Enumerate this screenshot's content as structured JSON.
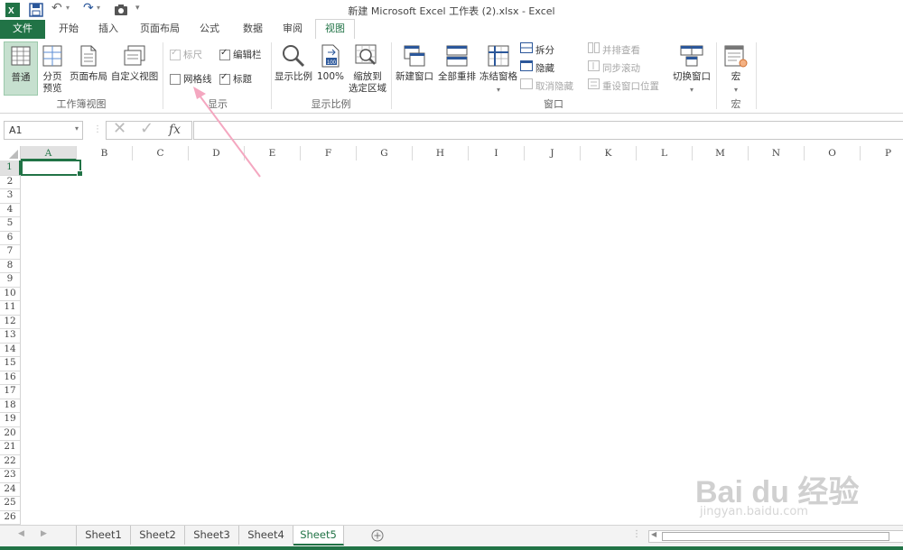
{
  "window": {
    "title": "新建 Microsoft Excel 工作表 (2).xlsx - Excel"
  },
  "tabs": [
    {
      "label": "文件"
    },
    {
      "label": "开始"
    },
    {
      "label": "插入"
    },
    {
      "label": "页面布局"
    },
    {
      "label": "公式"
    },
    {
      "label": "数据"
    },
    {
      "label": "审阅"
    },
    {
      "label": "视图"
    }
  ],
  "ribbon": {
    "workbook_views": {
      "label": "工作簿视图",
      "normal": "普通",
      "page_break_line1": "分页",
      "page_break_line2": "预览",
      "page_layout": "页面布局",
      "custom_views": "自定义视图"
    },
    "show": {
      "label": "显示",
      "ruler": "标尺",
      "formula_bar": "编辑栏",
      "gridlines": "网格线",
      "headings": "标题",
      "ruler_checked": true,
      "formula_bar_checked": true,
      "gridlines_checked": false,
      "headings_checked": true
    },
    "zoom": {
      "label": "显示比例",
      "zoom": "显示比例",
      "hundred": "100%",
      "zoom_sel_line1": "缩放到",
      "zoom_sel_line2": "选定区域"
    },
    "window": {
      "label": "窗口",
      "new_window": "新建窗口",
      "arrange_all": "全部重排",
      "freeze_panes": "冻结窗格",
      "split": "拆分",
      "hide": "隐藏",
      "unhide": "取消隐藏",
      "side_by_side": "并排查看",
      "sync_scroll": "同步滚动",
      "reset_position": "重设窗口位置",
      "switch_windows": "切换窗口"
    },
    "macros": {
      "label": "宏",
      "macros": "宏"
    }
  },
  "formula_bar": {
    "name_box": "A1",
    "fx": "fx",
    "value": ""
  },
  "grid": {
    "columns": [
      "A",
      "B",
      "C",
      "D",
      "E",
      "F",
      "G",
      "H",
      "I",
      "J",
      "K",
      "L",
      "M",
      "N",
      "O",
      "P"
    ],
    "rows": [
      "1",
      "2",
      "3",
      "4",
      "5",
      "6",
      "7",
      "8",
      "9",
      "10",
      "11",
      "12",
      "13",
      "14",
      "15",
      "16",
      "17",
      "18",
      "19",
      "20",
      "21",
      "22",
      "23",
      "24",
      "25",
      "26"
    ],
    "selected_cell": "A1"
  },
  "sheets": [
    "Sheet1",
    "Sheet2",
    "Sheet3",
    "Sheet4",
    "Sheet5"
  ],
  "active_sheet": "Sheet5",
  "watermark": {
    "line1": "Bai du 经验",
    "line2": "jingyan.baidu.com"
  },
  "colors": {
    "accent": "#217346",
    "arrow": "#f4a7c0"
  }
}
